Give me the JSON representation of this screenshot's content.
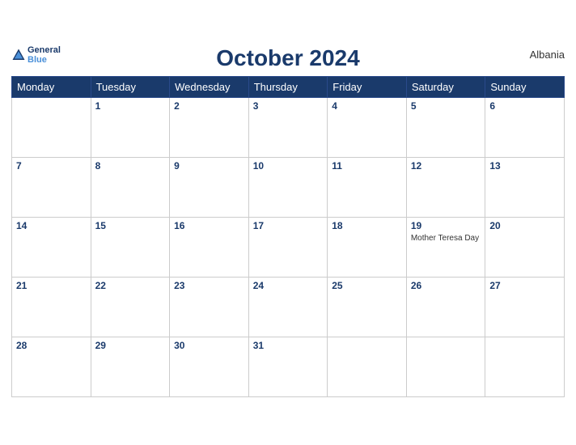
{
  "header": {
    "logo": {
      "general": "General",
      "blue": "Blue"
    },
    "title": "October 2024",
    "country": "Albania"
  },
  "weekdays": [
    "Monday",
    "Tuesday",
    "Wednesday",
    "Thursday",
    "Friday",
    "Saturday",
    "Sunday"
  ],
  "weeks": [
    [
      {
        "day": null,
        "holiday": null
      },
      {
        "day": "1",
        "holiday": null
      },
      {
        "day": "2",
        "holiday": null
      },
      {
        "day": "3",
        "holiday": null
      },
      {
        "day": "4",
        "holiday": null
      },
      {
        "day": "5",
        "holiday": null
      },
      {
        "day": "6",
        "holiday": null
      }
    ],
    [
      {
        "day": "7",
        "holiday": null
      },
      {
        "day": "8",
        "holiday": null
      },
      {
        "day": "9",
        "holiday": null
      },
      {
        "day": "10",
        "holiday": null
      },
      {
        "day": "11",
        "holiday": null
      },
      {
        "day": "12",
        "holiday": null
      },
      {
        "day": "13",
        "holiday": null
      }
    ],
    [
      {
        "day": "14",
        "holiday": null
      },
      {
        "day": "15",
        "holiday": null
      },
      {
        "day": "16",
        "holiday": null
      },
      {
        "day": "17",
        "holiday": null
      },
      {
        "day": "18",
        "holiday": null
      },
      {
        "day": "19",
        "holiday": "Mother Teresa Day"
      },
      {
        "day": "20",
        "holiday": null
      }
    ],
    [
      {
        "day": "21",
        "holiday": null
      },
      {
        "day": "22",
        "holiday": null
      },
      {
        "day": "23",
        "holiday": null
      },
      {
        "day": "24",
        "holiday": null
      },
      {
        "day": "25",
        "holiday": null
      },
      {
        "day": "26",
        "holiday": null
      },
      {
        "day": "27",
        "holiday": null
      }
    ],
    [
      {
        "day": "28",
        "holiday": null
      },
      {
        "day": "29",
        "holiday": null
      },
      {
        "day": "30",
        "holiday": null
      },
      {
        "day": "31",
        "holiday": null
      },
      {
        "day": null,
        "holiday": null
      },
      {
        "day": null,
        "holiday": null
      },
      {
        "day": null,
        "holiday": null
      }
    ]
  ],
  "colors": {
    "header_bg": "#1a3a6b",
    "header_text": "#ffffff",
    "border": "#cccccc",
    "day_number": "#1a3a6b"
  }
}
